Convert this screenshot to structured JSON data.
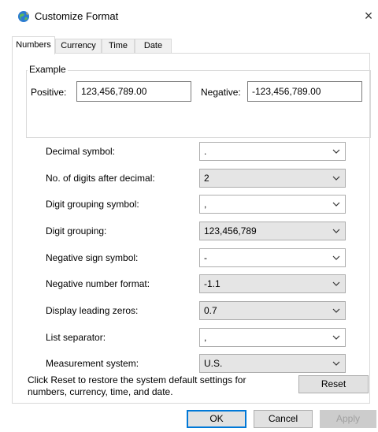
{
  "window": {
    "title": "Customize Format",
    "close_icon": "×"
  },
  "tabs": [
    {
      "label": "Numbers",
      "active": true
    },
    {
      "label": "Currency",
      "active": false
    },
    {
      "label": "Time",
      "active": false
    },
    {
      "label": "Date",
      "active": false
    }
  ],
  "example": {
    "legend": "Example",
    "positive_label": "Positive:",
    "positive_value": "123,456,789.00",
    "negative_label": "Negative:",
    "negative_value": "-123,456,789.00"
  },
  "settings": [
    {
      "label": "Decimal symbol:",
      "value": ".",
      "editable": true
    },
    {
      "label": "No. of digits after decimal:",
      "value": "2",
      "editable": false
    },
    {
      "label": "Digit grouping symbol:",
      "value": ",",
      "editable": true
    },
    {
      "label": "Digit grouping:",
      "value": "123,456,789",
      "editable": false
    },
    {
      "label": "Negative sign symbol:",
      "value": "-",
      "editable": true
    },
    {
      "label": "Negative number format:",
      "value": "-1.1",
      "editable": false
    },
    {
      "label": "Display leading zeros:",
      "value": "0.7",
      "editable": false
    },
    {
      "label": "List separator:",
      "value": ",",
      "editable": true
    },
    {
      "label": "Measurement system:",
      "value": "U.S.",
      "editable": false
    }
  ],
  "reset_hint": "Click Reset to restore the system default settings for numbers, currency, time, and date.",
  "buttons": {
    "reset": "Reset",
    "ok": "OK",
    "cancel": "Cancel",
    "apply": "Apply"
  },
  "colors": {
    "accent": "#0078d7",
    "readonly_combo": "#e5e5e5",
    "border": "#d9d9d9"
  }
}
